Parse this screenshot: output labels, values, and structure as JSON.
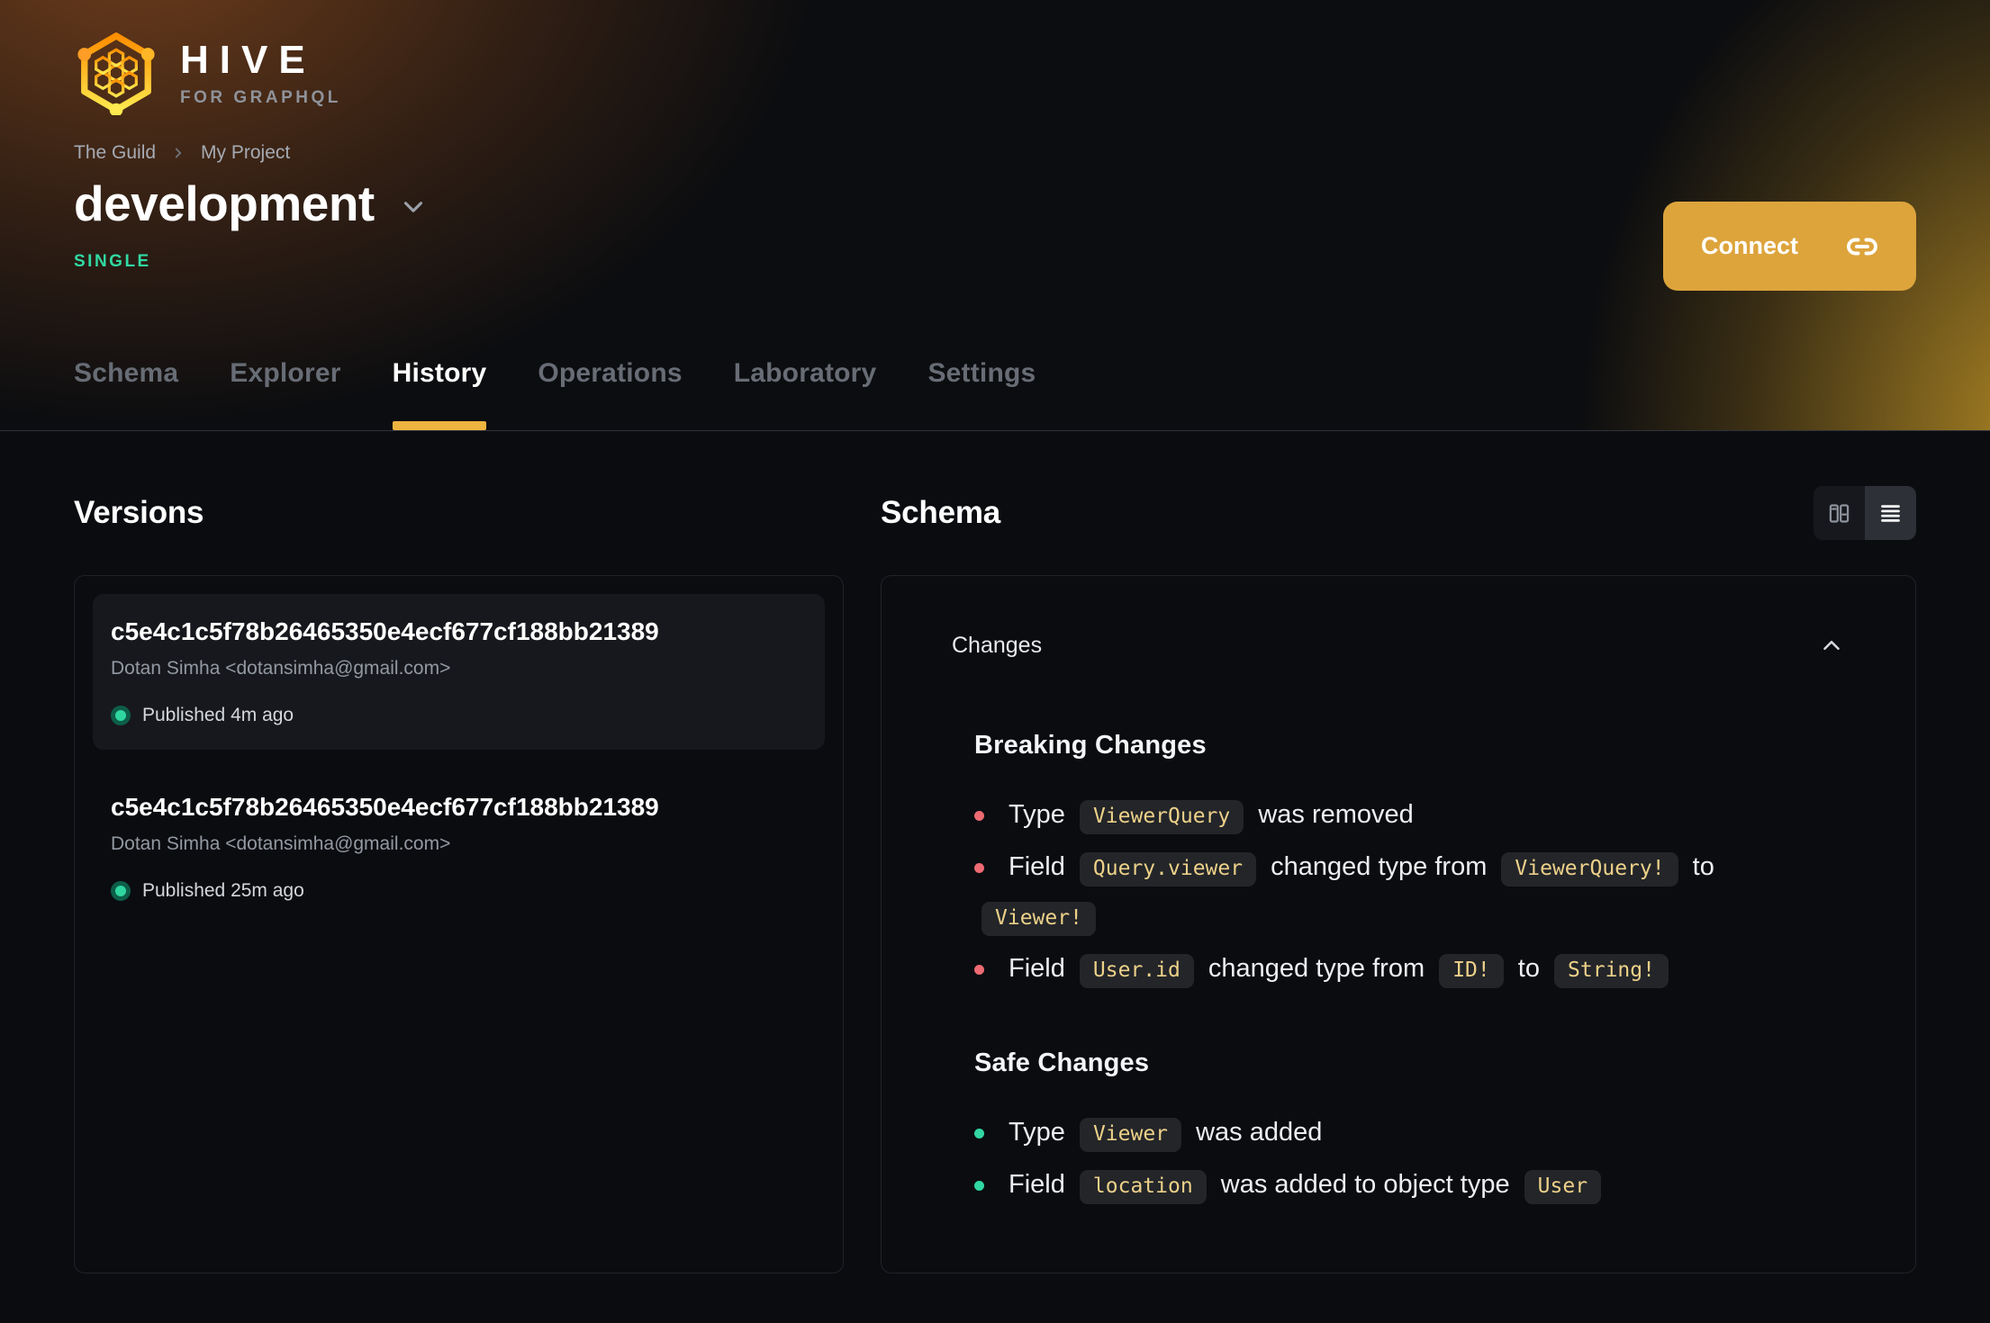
{
  "brand": {
    "name": "HIVE",
    "tagline": "FOR GRAPHQL"
  },
  "breadcrumb": {
    "org": "The Guild",
    "project": "My Project"
  },
  "target": {
    "name": "development",
    "badge": "SINGLE"
  },
  "header": {
    "connect_label": "Connect"
  },
  "tabs": [
    {
      "label": "Schema",
      "active": false
    },
    {
      "label": "Explorer",
      "active": false
    },
    {
      "label": "History",
      "active": true
    },
    {
      "label": "Operations",
      "active": false
    },
    {
      "label": "Laboratory",
      "active": false
    },
    {
      "label": "Settings",
      "active": false
    }
  ],
  "versions": {
    "title": "Versions",
    "items": [
      {
        "hash": "c5e4c1c5f78b26465350e4ecf677cf188bb21389",
        "author": "Dotan Simha <dotansimha@gmail.com>",
        "status": "Published 4m ago",
        "highlighted": true
      },
      {
        "hash": "c5e4c1c5f78b26465350e4ecf677cf188bb21389",
        "author": "Dotan Simha <dotansimha@gmail.com>",
        "status": "Published 25m ago",
        "highlighted": false
      }
    ]
  },
  "schema": {
    "title": "Schema",
    "changes_label": "Changes",
    "view_toggle": [
      "split-view",
      "list-view"
    ],
    "groups": [
      {
        "title": "Breaking Changes",
        "severity": "breaking",
        "items": [
          "Type `ViewerQuery` was removed",
          "Field `Query.viewer` changed type from `ViewerQuery!` to `Viewer!`",
          "Field `User.id` changed type from `ID!` to `String!`"
        ]
      },
      {
        "title": "Safe Changes",
        "severity": "safe",
        "items": [
          "Type `Viewer` was added",
          "Field `location` was added to object type `User`"
        ]
      }
    ]
  },
  "colors": {
    "accent_gold": "#dda43c",
    "tab_underline": "#eeb440",
    "badge_green": "#30d9a2",
    "status_dot_green": "#2fd6a0",
    "breaking_bullet_red": "#ed6a72",
    "safe_bullet_green": "#31d7a2",
    "code_chip_text": "#edd189"
  }
}
